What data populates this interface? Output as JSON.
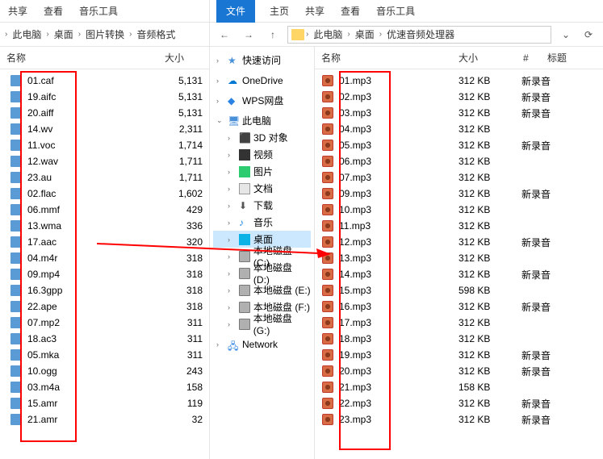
{
  "left_window": {
    "tabs": [
      "共享",
      "查看",
      "音乐工具"
    ],
    "breadcrumb": [
      "此电脑",
      "桌面",
      "图片转换",
      "音频格式"
    ],
    "columns": {
      "name": "名称",
      "size": "大小"
    },
    "files": [
      {
        "name": "01.caf",
        "size": "5,131"
      },
      {
        "name": "19.aifc",
        "size": "5,131"
      },
      {
        "name": "20.aiff",
        "size": "5,131"
      },
      {
        "name": "14.wv",
        "size": "2,311"
      },
      {
        "name": "11.voc",
        "size": "1,714"
      },
      {
        "name": "12.wav",
        "size": "1,711"
      },
      {
        "name": "23.au",
        "size": "1,711"
      },
      {
        "name": "02.flac",
        "size": "1,602"
      },
      {
        "name": "06.mmf",
        "size": "429"
      },
      {
        "name": "13.wma",
        "size": "336"
      },
      {
        "name": "17.aac",
        "size": "320"
      },
      {
        "name": "04.m4r",
        "size": "318"
      },
      {
        "name": "09.mp4",
        "size": "318"
      },
      {
        "name": "16.3gpp",
        "size": "318"
      },
      {
        "name": "22.ape",
        "size": "318"
      },
      {
        "name": "07.mp2",
        "size": "311"
      },
      {
        "name": "18.ac3",
        "size": "311"
      },
      {
        "name": "05.mka",
        "size": "311"
      },
      {
        "name": "10.ogg",
        "size": "243"
      },
      {
        "name": "03.m4a",
        "size": "158"
      },
      {
        "name": "15.amr",
        "size": "119"
      },
      {
        "name": "21.amr",
        "size": "32"
      }
    ]
  },
  "right_window": {
    "tabs": [
      "文件",
      "主页",
      "共享",
      "查看",
      "音乐工具"
    ],
    "breadcrumb": [
      "此电脑",
      "桌面",
      "优速音频处理器"
    ],
    "tree": {
      "quick_access": "快速访问",
      "onedrive": "OneDrive",
      "wps": "WPS网盘",
      "this_pc": "此电脑",
      "children": [
        {
          "label": "3D 对象"
        },
        {
          "label": "视频"
        },
        {
          "label": "图片"
        },
        {
          "label": "文档"
        },
        {
          "label": "下载"
        },
        {
          "label": "音乐"
        },
        {
          "label": "桌面",
          "selected": true
        },
        {
          "label": "本地磁盘 (C:)"
        },
        {
          "label": "本地磁盘 (D:)"
        },
        {
          "label": "本地磁盘 (E:)"
        },
        {
          "label": "本地磁盘 (F:)"
        },
        {
          "label": "本地磁盘 (G:)"
        }
      ],
      "network": "Network"
    },
    "columns": {
      "name": "名称",
      "size": "大小",
      "index": "#",
      "title": "标题"
    },
    "files": [
      {
        "name": "01.mp3",
        "size": "312 KB",
        "title": "新录音"
      },
      {
        "name": "02.mp3",
        "size": "312 KB",
        "title": "新录音"
      },
      {
        "name": "03.mp3",
        "size": "312 KB",
        "title": "新录音"
      },
      {
        "name": "04.mp3",
        "size": "312 KB",
        "title": ""
      },
      {
        "name": "05.mp3",
        "size": "312 KB",
        "title": "新录音"
      },
      {
        "name": "06.mp3",
        "size": "312 KB",
        "title": ""
      },
      {
        "name": "07.mp3",
        "size": "312 KB",
        "title": ""
      },
      {
        "name": "09.mp3",
        "size": "312 KB",
        "title": "新录音"
      },
      {
        "name": "10.mp3",
        "size": "312 KB",
        "title": ""
      },
      {
        "name": "11.mp3",
        "size": "312 KB",
        "title": ""
      },
      {
        "name": "12.mp3",
        "size": "312 KB",
        "title": "新录音"
      },
      {
        "name": "13.mp3",
        "size": "312 KB",
        "title": ""
      },
      {
        "name": "14.mp3",
        "size": "312 KB",
        "title": "新录音"
      },
      {
        "name": "15.mp3",
        "size": "598 KB",
        "title": ""
      },
      {
        "name": "16.mp3",
        "size": "312 KB",
        "title": "新录音"
      },
      {
        "name": "17.mp3",
        "size": "312 KB",
        "title": ""
      },
      {
        "name": "18.mp3",
        "size": "312 KB",
        "title": ""
      },
      {
        "name": "19.mp3",
        "size": "312 KB",
        "title": "新录音"
      },
      {
        "name": "20.mp3",
        "size": "312 KB",
        "title": "新录音"
      },
      {
        "name": "21.mp3",
        "size": "158 KB",
        "title": ""
      },
      {
        "name": "22.mp3",
        "size": "312 KB",
        "title": "新录音"
      },
      {
        "name": "23.mp3",
        "size": "312 KB",
        "title": "新录音"
      }
    ]
  }
}
